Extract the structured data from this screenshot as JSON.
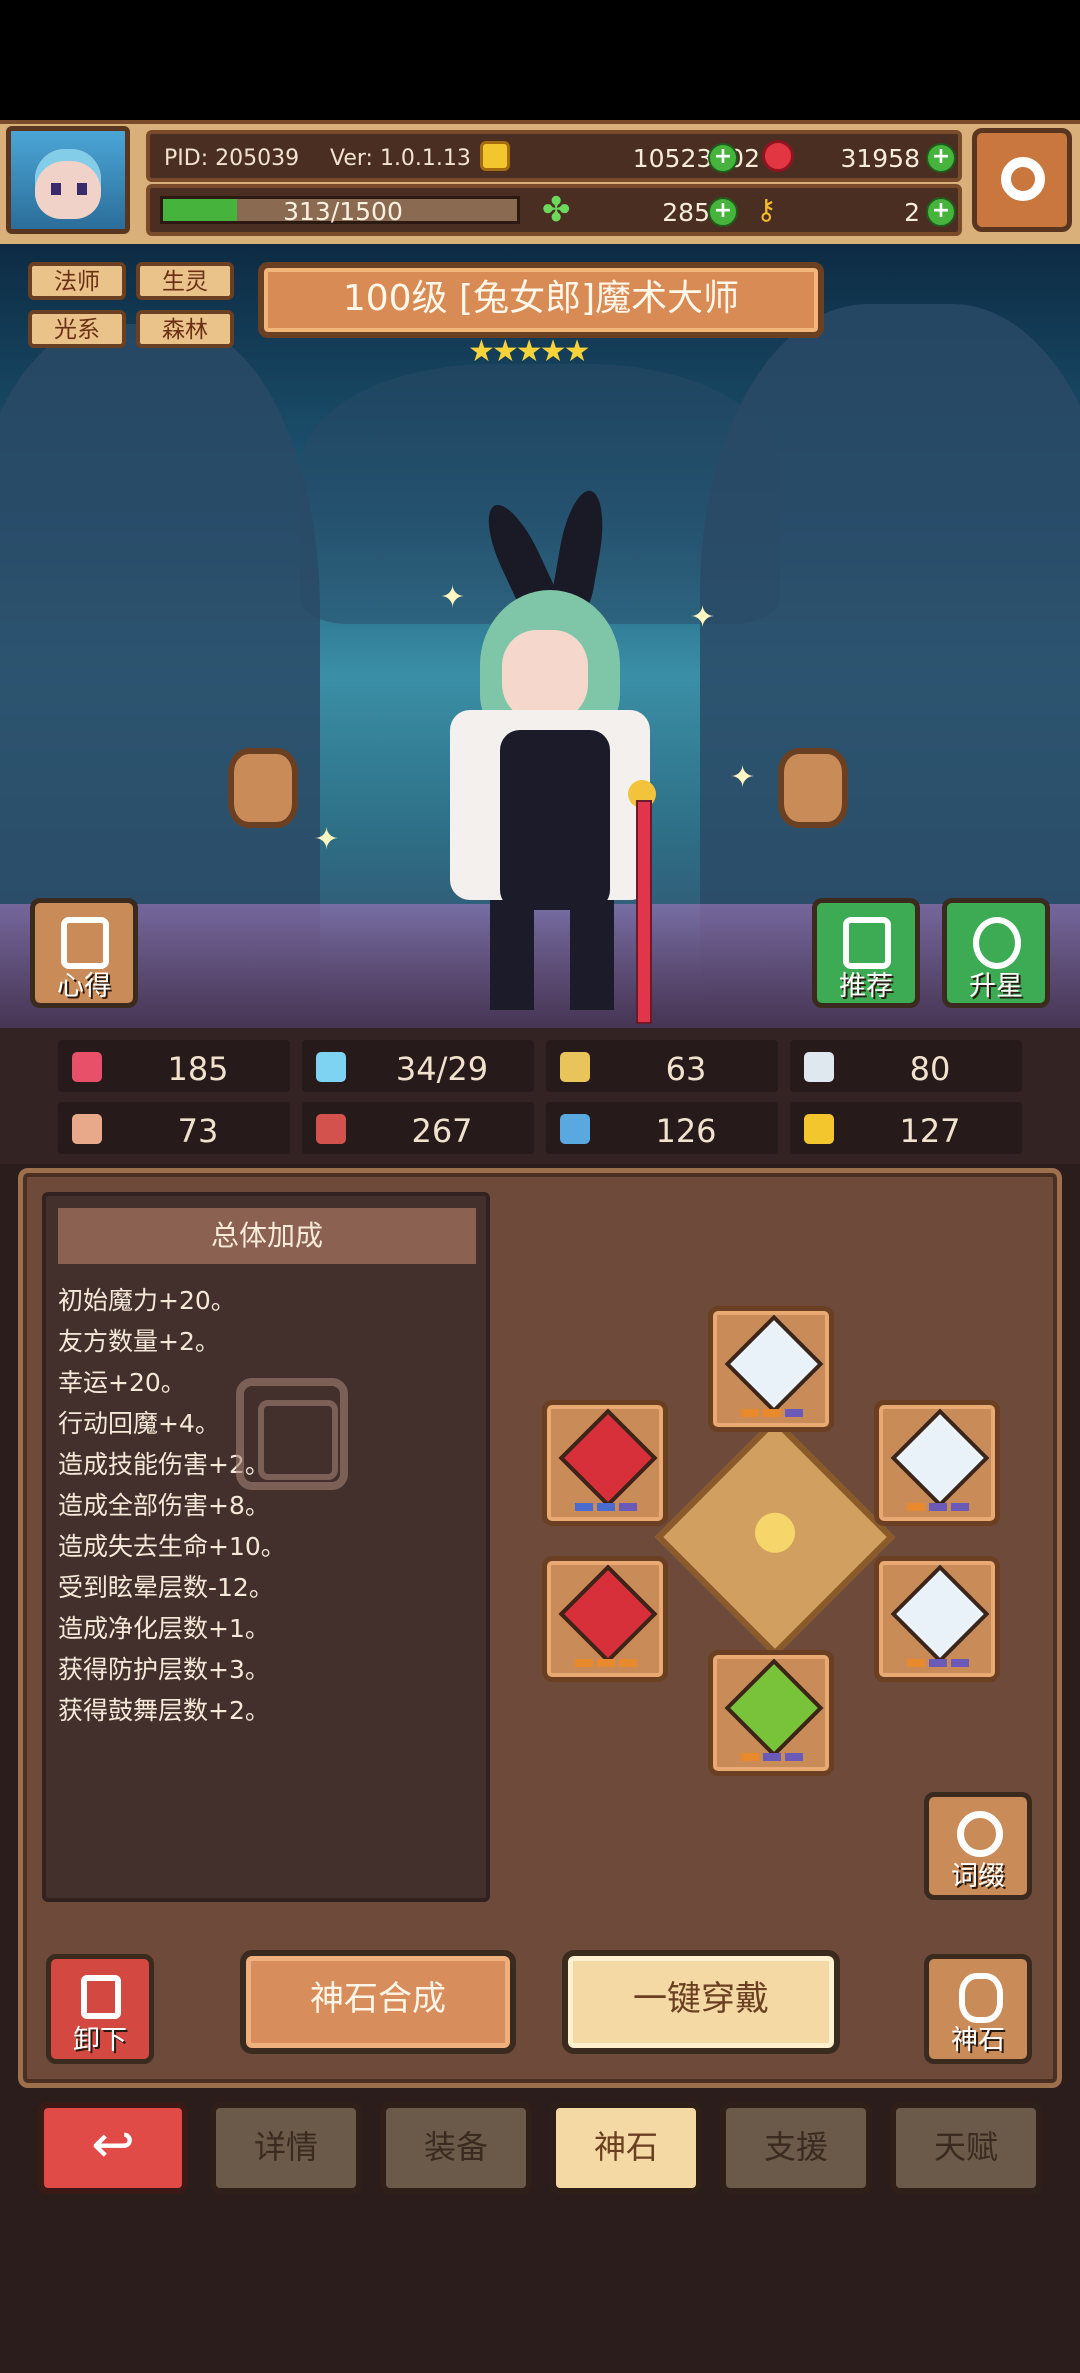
{
  "header": {
    "pid": "PID: 205039",
    "version": "Ver: 1.0.1.13",
    "gold": "10523202",
    "ruby": "31958",
    "clover": "285",
    "keys": "2",
    "xp_text": "313/1500",
    "xp_fraction": 0.21
  },
  "tags": [
    "法师",
    "生灵",
    "光系",
    "森林"
  ],
  "hero": {
    "title": "100级 [兔女郎]魔术大师",
    "stars": "★★★★★"
  },
  "side_buttons": {
    "insight": "心得",
    "recommend": "推荐",
    "star_up": "升星"
  },
  "stats": [
    {
      "icon": "heart-icon",
      "value": "185",
      "color": "#e8506a"
    },
    {
      "icon": "mana-drop-icon",
      "value": "34/29",
      "color": "#7fd3f2"
    },
    {
      "icon": "shield-icon",
      "value": "63",
      "color": "#e9c45a"
    },
    {
      "icon": "wing-icon",
      "value": "80",
      "color": "#dfe8ef"
    },
    {
      "icon": "fist-icon",
      "value": "73",
      "color": "#e7a98a"
    },
    {
      "icon": "spellbook-icon",
      "value": "267",
      "color": "#d4524e"
    },
    {
      "icon": "scroll-icon",
      "value": "126",
      "color": "#5aa8e0"
    },
    {
      "icon": "horseshoe-icon",
      "value": "127",
      "color": "#f2c62c"
    }
  ],
  "bonus": {
    "title": "总体加成",
    "lines": [
      "初始魔力+20。",
      "友方数量+2。",
      "幸运+20。",
      "行动回魔+4。",
      "造成技能伤害+2。",
      "造成全部伤害+8。",
      "造成失去生命+10。",
      "受到眩晕层数-12。",
      "造成净化层数+1。",
      "获得防护层数+3。",
      "获得鼓舞层数+2。"
    ]
  },
  "actions": {
    "affix": "词缀",
    "unequip": "卸下",
    "combine": "神石合成",
    "one_click": "一键穿戴",
    "god_stone": "神石"
  },
  "tabs": [
    "详情",
    "装备",
    "神石",
    "支援",
    "天赋"
  ],
  "active_tab": "神石",
  "colors": {
    "gem_red": "#d7303b",
    "gem_white": "#e8f2f8",
    "gem_green": "#79c33b",
    "accent_green": "#46b43c"
  }
}
